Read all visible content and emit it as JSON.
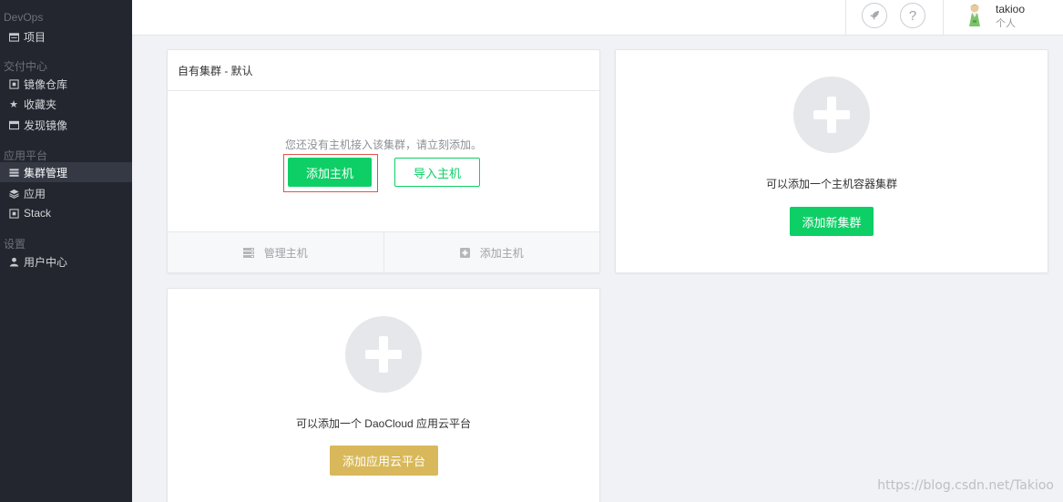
{
  "sidebar": {
    "sections": [
      {
        "title": "DevOps",
        "items": [
          {
            "label": "项目",
            "icon": "folder-icon"
          }
        ]
      },
      {
        "title": "交付中心",
        "items": [
          {
            "label": "镜像仓库",
            "icon": "repository-icon"
          },
          {
            "label": "收藏夹",
            "icon": "star-icon"
          },
          {
            "label": "发现镜像",
            "icon": "discover-icon"
          }
        ]
      },
      {
        "title": "应用平台",
        "items": [
          {
            "label": "集群管理",
            "icon": "list-icon",
            "active": true
          },
          {
            "label": "应用",
            "icon": "layers-icon"
          },
          {
            "label": "Stack",
            "icon": "stack-icon"
          }
        ]
      },
      {
        "title": "设置",
        "items": [
          {
            "label": "用户中心",
            "icon": "user-icon"
          }
        ]
      }
    ]
  },
  "topbar": {
    "user_name": "takioo",
    "user_role": "个人",
    "icons": [
      "rocket-icon",
      "help-icon"
    ]
  },
  "cluster_card": {
    "title": "自有集群 - 默认",
    "empty_message": "您还没有主机接入该集群，请立刻添加。",
    "add_host_button": "添加主机",
    "import_host_button": "导入主机",
    "footer_manage": "管理主机",
    "footer_add": "添加主机"
  },
  "add_cluster_card": {
    "text": "可以添加一个主机容器集群",
    "button": "添加新集群"
  },
  "add_platform_card": {
    "text": "可以添加一个 DaoCloud 应用云平台",
    "button": "添加应用云平台"
  },
  "watermark": "https://blog.csdn.net/Takioo",
  "colors": {
    "sidebar_bg": "#23262e",
    "primary_green": "#0ecf66",
    "gold": "#d8b85a",
    "highlight_red": "#e2534a"
  }
}
